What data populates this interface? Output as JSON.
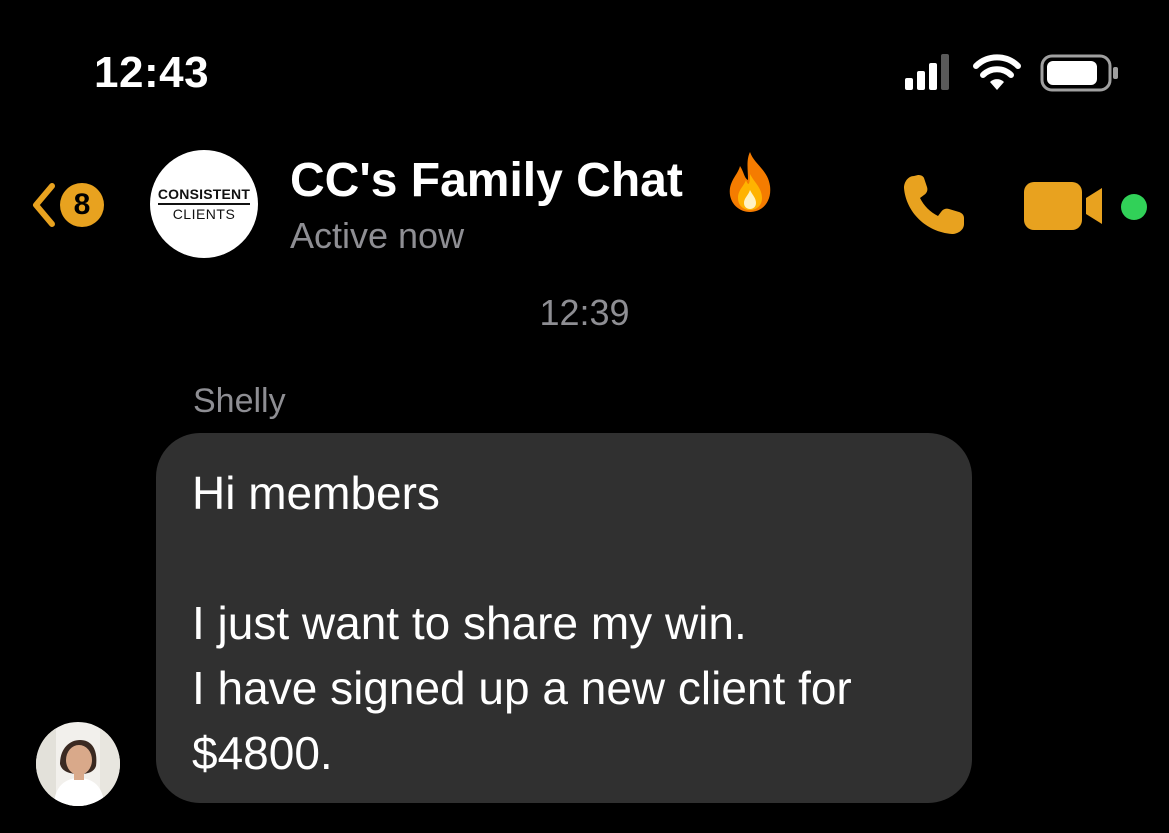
{
  "status_bar": {
    "time": "12:43",
    "icons": [
      "signal-icon",
      "wifi-icon",
      "battery-icon"
    ]
  },
  "header": {
    "back_badge_count": "8",
    "group_avatar": {
      "line1": "CONSISTENT",
      "line2": "CLIENTS"
    },
    "title": "CC's Family Chat",
    "title_emoji": "fire-icon",
    "subtitle": "Active now",
    "actions": [
      "call-icon",
      "video-icon"
    ],
    "online": true
  },
  "conversation": {
    "timestamp": "12:39",
    "messages": [
      {
        "sender": "Shelly",
        "lines": [
          "Hi members",
          "",
          "I just want to share my win.",
          "I have signed up a new client for",
          "$4800."
        ]
      }
    ]
  },
  "colors": {
    "background": "#000000",
    "accent": "#e8a21f",
    "bubble": "#303030",
    "secondary_text": "#8e8e93",
    "online": "#31d158"
  }
}
